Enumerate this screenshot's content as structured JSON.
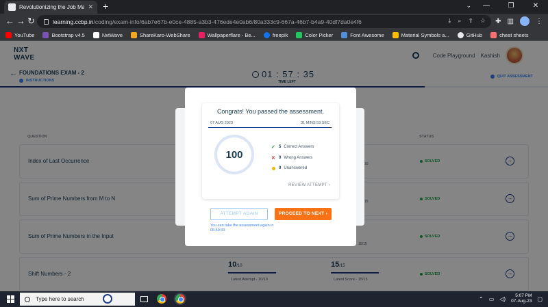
{
  "browser": {
    "tab_title": "Revolutionizing the Job Market |",
    "url_domain": "learning.ccbp.in",
    "url_path": "/coding/exam-info/6ab7e67b-e0ce-4885-a3b3-476ede4e0ab6/80a333c9-667a-46b7-b4a9-40df7da0e4f6",
    "bookmarks": [
      {
        "label": "YouTube",
        "color": "#ff0000"
      },
      {
        "label": "Bootstrap v4.5",
        "color": "#7952b3"
      },
      {
        "label": "NxtWave",
        "color": "#ffffff"
      },
      {
        "label": "ShareKaro-WebShare",
        "color": "#f5a623"
      },
      {
        "label": "Wallpaperflare - Be...",
        "color": "#e91e63"
      },
      {
        "label": "freepik",
        "color": "#1273eb"
      },
      {
        "label": "Color Picker",
        "color": "#22c55e"
      },
      {
        "label": "Font Awesome",
        "color": "#528dd7"
      },
      {
        "label": "Material Symbols a...",
        "color": "#fbbc05"
      },
      {
        "label": "GitHub",
        "color": "#e8eaed"
      },
      {
        "label": "cheat sheets",
        "color": "#f87171"
      }
    ]
  },
  "site": {
    "logo_line1": "NXT",
    "logo_line2": "WAVE",
    "playground": "Code Playground",
    "user": "Kashish"
  },
  "exam": {
    "title": "FOUNDATIONS EXAM - 2",
    "instructions": "INSTRUCTIONS",
    "timer": "01 : 57 : 35",
    "time_left": "TIME LEFT",
    "quit": "QUIT ASSESSMENT",
    "col_question": "QUESTION",
    "col_status": "STATUS",
    "questions": [
      {
        "name": "Index of Last Occurrence",
        "status": "SOLVED"
      },
      {
        "name": "Sum of Prime Numbers from M to N",
        "status": "SOLVED"
      },
      {
        "name": "Sum of Prime Numbers in the Input",
        "status": "SOLVED"
      },
      {
        "name": "Shift Numbers - 2",
        "status": "SOLVED",
        "attempt_score": "10",
        "attempt_total": "/10",
        "best_score": "15",
        "best_total": "/15",
        "latest_attempt": "Latest Attempt - 10/10",
        "latest_score": "Latest Score - 15/15"
      }
    ],
    "peek": [
      "10",
      "15",
      "15/15"
    ]
  },
  "modal": {
    "congrats": "Congrats! You passed the assessment.",
    "date": "07 AUG 2023",
    "duration": "31 MINS 53 SEC",
    "score": "100",
    "correct_count": "5",
    "correct_label": "Correct Answers",
    "wrong_count": "0",
    "wrong_label": "Wrong Answers",
    "unanswered_count": "0",
    "unanswered_label": "Unanswered",
    "review": "REVIEW ATTEMPT",
    "attempt_again": "ATTEMPT AGAIN",
    "proceed": "PROCEED TO NEXT",
    "hint": "You can take the assessment again in 05:59:33"
  },
  "taskbar": {
    "search_placeholder": "Type here to search",
    "time": "5:07 PM",
    "date": "07-Aug-23"
  }
}
